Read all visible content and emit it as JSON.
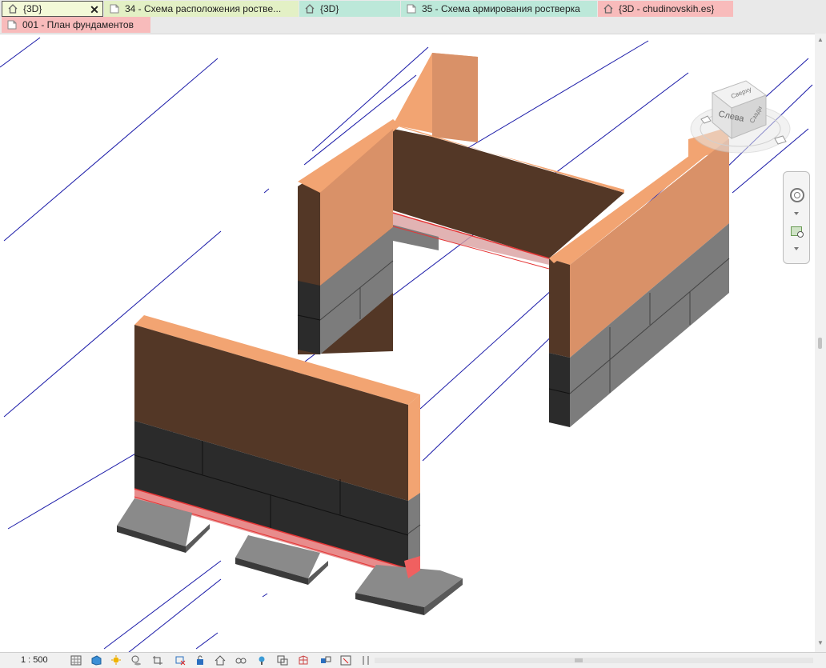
{
  "tabs": [
    {
      "label": "{3D}",
      "icon": "home-icon",
      "active": true,
      "color": "#f3f9d8"
    },
    {
      "label": "34 - Схема расположения роствe...",
      "icon": "sheet-icon",
      "active": false,
      "color": "#e3f0c5"
    },
    {
      "label": "{3D}",
      "icon": "home-icon",
      "active": false,
      "color": "#bce8d9"
    },
    {
      "label": "35 - Схема армирования ростверка",
      "icon": "sheet-icon",
      "active": false,
      "color": "#bce8d9"
    },
    {
      "label": "{3D - chudinovskih.es}",
      "icon": "home-icon",
      "active": false,
      "color": "#f8bbbb"
    },
    {
      "label": "001 - План фундаментов",
      "icon": "sheet-icon",
      "active": false,
      "color": "#f8bbbb"
    }
  ],
  "close_glyph": "✕",
  "viewcube": {
    "left_face": "Слева",
    "top_face": "Сверху",
    "right_face": "Сзади"
  },
  "status": {
    "scale": "1 : 500"
  },
  "colors": {
    "wall_front": "#533726",
    "wall_side": "#d99168",
    "wall_top": "#f2a472",
    "block_dark": "#2b2b2b",
    "block_gray": "#7c7c7c",
    "grid_line": "#1a1aa8",
    "rebar": "#e53535"
  },
  "status_icons": [
    "detail-level-icon",
    "visual-style-icon",
    "sun-path-icon",
    "shadows-icon",
    "crop-view-icon",
    "crop-region-icon",
    "unlock-3d-icon",
    "temporary-hide-icon",
    "reveal-hidden-icon",
    "temporary-view-props-icon",
    "highlight-displacement-icon",
    "analytical-model-icon",
    "worksharing-icon",
    "reveal-constraints-icon",
    "show-cropped-icon",
    "section-box-icon"
  ]
}
